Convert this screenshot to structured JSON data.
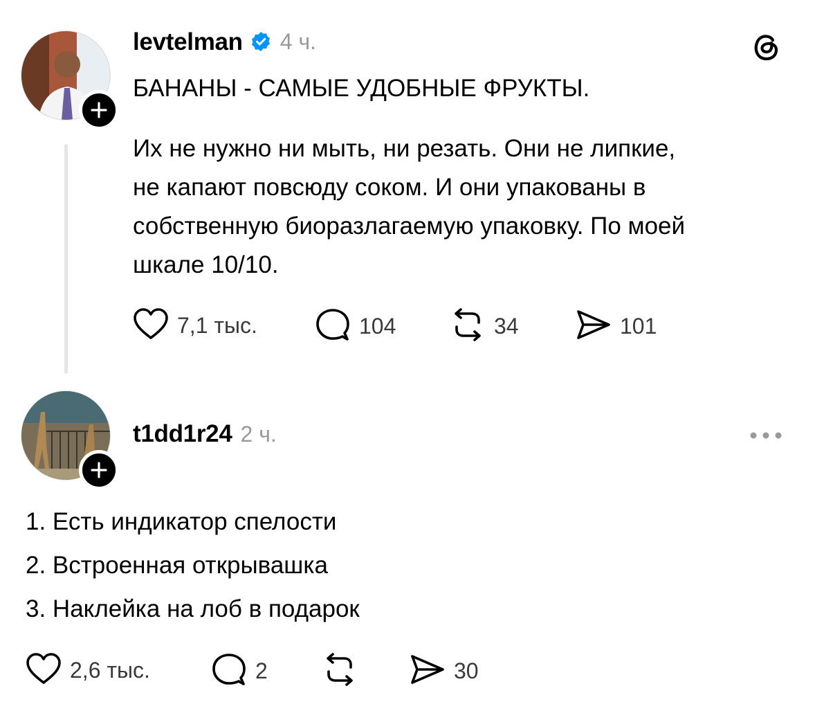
{
  "post": {
    "username": "levtelman",
    "time": "4 ч.",
    "title": "БАНАНЫ - САМЫЕ УДОБНЫЕ ФРУКТЫ.",
    "body_lines": [
      "Их не нужно ни мыть, ни резать. Они не липкие,",
      "не капают повсюду соком. И они упакованы в",
      "собственную биоразлагаемую упаковку. По моей",
      "шкале 10/10."
    ],
    "likes": "7,1 тыс.",
    "replies": "104",
    "reposts": "34",
    "shares": "101",
    "icons": {
      "verified": "verified-badge-icon",
      "app": "threads-logo-icon"
    },
    "colors": {
      "verified": "#0095f6"
    }
  },
  "reply": {
    "username": "t1dd1r24",
    "time": "2 ч.",
    "lines": [
      "1. Есть индикатор спелости",
      "2. Встроенная открывашка",
      "3. Наклейка на лоб в подарок"
    ],
    "likes": "2,6 тыс.",
    "replies": "2",
    "reposts": "",
    "shares": "30"
  }
}
